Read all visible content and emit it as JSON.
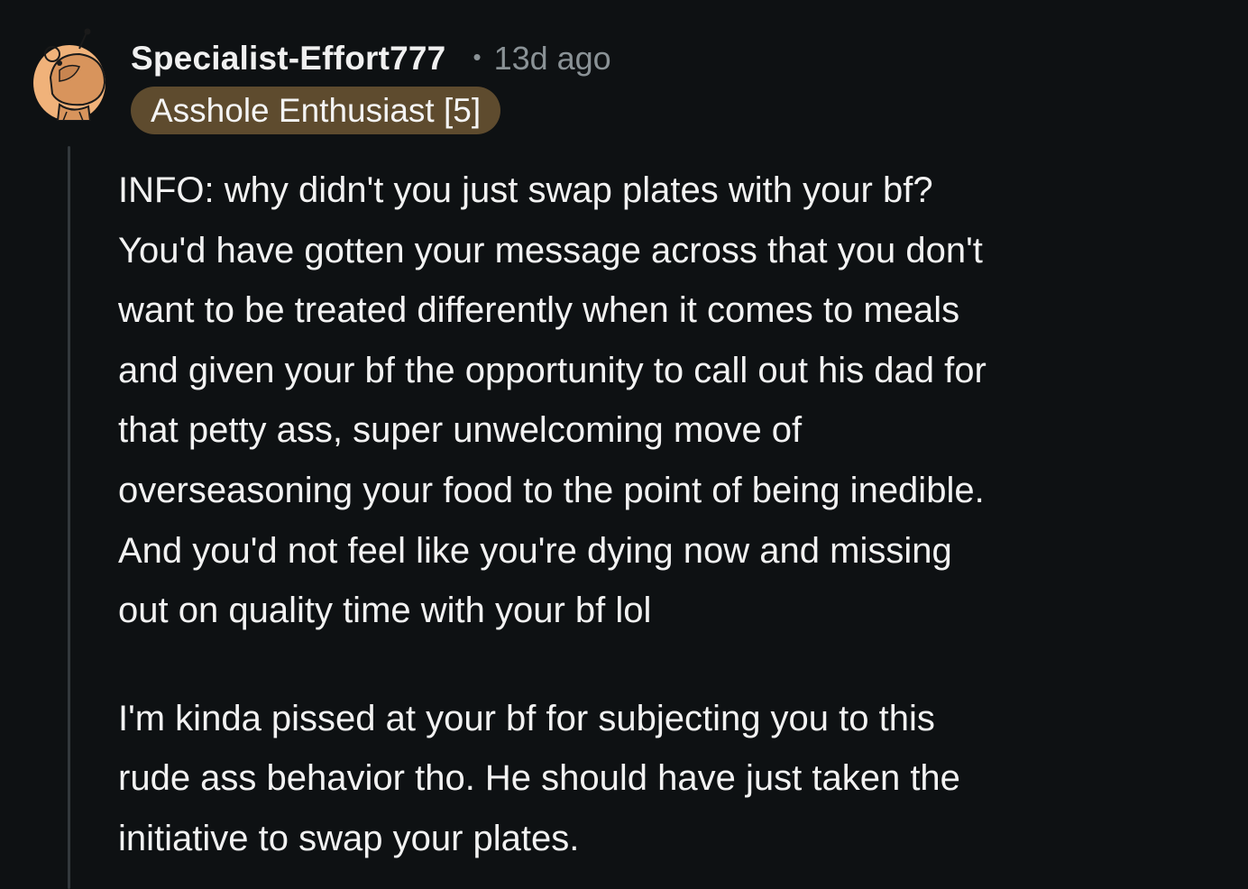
{
  "comment": {
    "author": "Specialist-Effort777",
    "separator": "•",
    "timestamp": "13d ago",
    "flair": "Asshole Enthusiast [5]",
    "paragraphs": [
      "INFO: why didn't you just swap plates with your bf?\nYou'd have gotten your message across that you don't\nwant to be treated differently when it comes to meals\nand given your bf the opportunity to call out his dad for\nthat petty ass, super unwelcoming move of\noverseasoning your food to the point of being inedible.\nAnd you'd not feel like you're dying now and missing\nout on quality time with your bf lol",
      "I'm kinda pissed at your bf for subjecting you to this\nrude ass behavior tho. He should have just taken the\ninitiative to swap your plates."
    ]
  },
  "colors": {
    "background": "#0e1113",
    "text": "#f2f2f2",
    "meta": "#8a9296",
    "flair_bg": "#5e4b2e",
    "avatar_bg": "#f0b27a",
    "thread_line": "#33393d"
  },
  "icons": {
    "avatar": "snoo-avatar-icon"
  }
}
